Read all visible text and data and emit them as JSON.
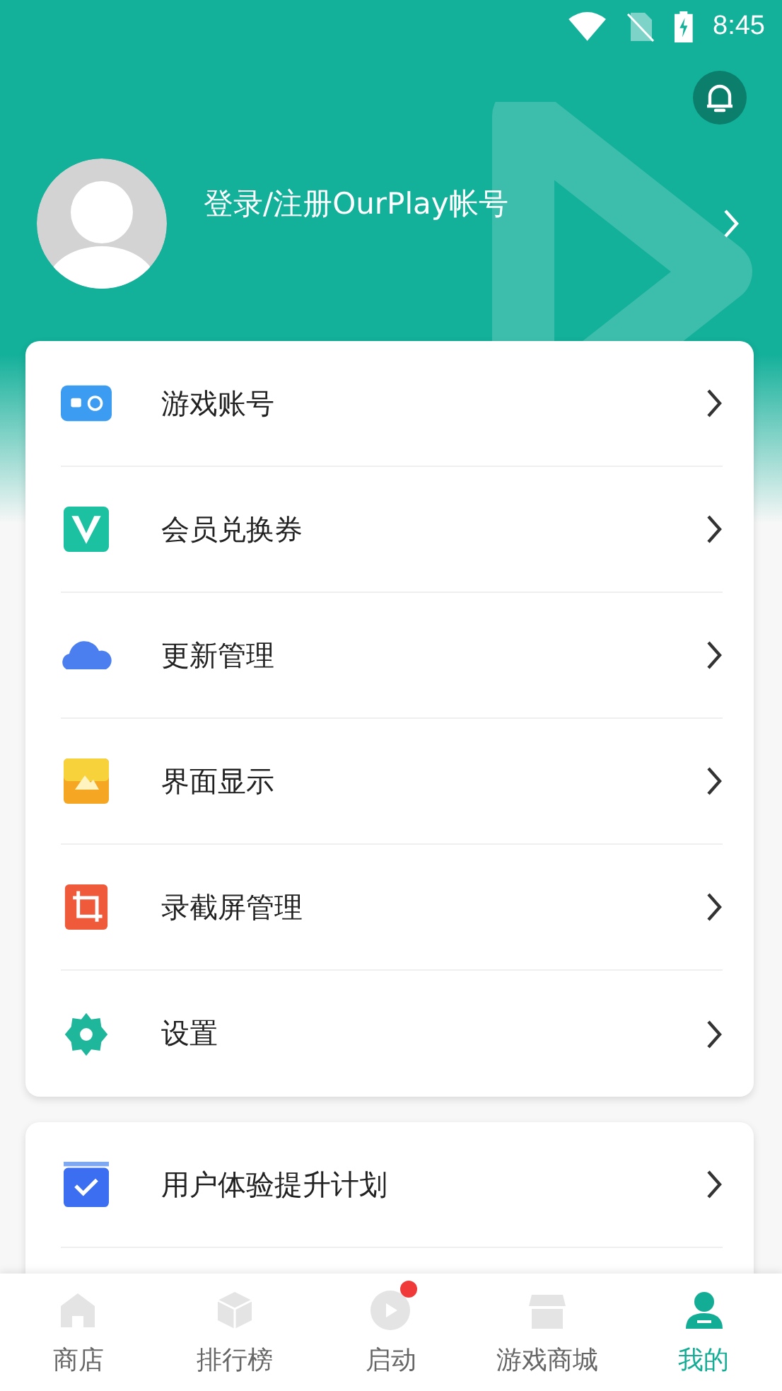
{
  "status_bar": {
    "time": "8:45"
  },
  "profile": {
    "login_text": "登录/注册OurPlay帐号"
  },
  "menu": [
    {
      "label": "游戏账号",
      "kind": "account"
    },
    {
      "label": "会员兑换券",
      "kind": "voucher"
    },
    {
      "label": "更新管理",
      "kind": "cloud"
    },
    {
      "label": "界面显示",
      "kind": "display"
    },
    {
      "label": "录截屏管理",
      "kind": "screen"
    },
    {
      "label": "设置",
      "kind": "settings"
    }
  ],
  "menu_2": [
    {
      "label": "用户体验提升计划",
      "kind": "plan"
    }
  ],
  "nav": [
    {
      "label": "商店",
      "kind": "store",
      "selected": false,
      "badge": false
    },
    {
      "label": "排行榜",
      "kind": "rank",
      "selected": false,
      "badge": false
    },
    {
      "label": "启动",
      "kind": "launch",
      "selected": false,
      "badge": true
    },
    {
      "label": "游戏商城",
      "kind": "mall",
      "selected": false,
      "badge": false
    },
    {
      "label": "我的",
      "kind": "me",
      "selected": true,
      "badge": false
    }
  ]
}
